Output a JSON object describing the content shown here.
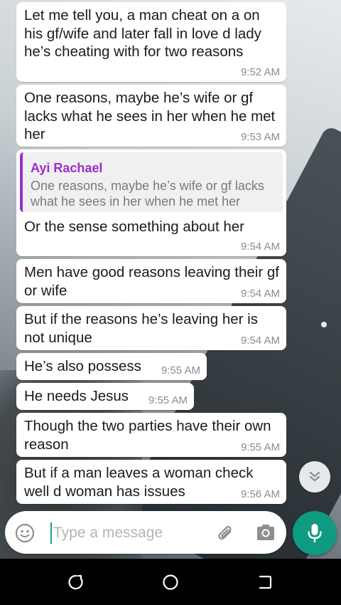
{
  "composer": {
    "placeholder": "Type a message"
  },
  "messages": [
    {
      "text": "Let me tell you, a man cheat on a on his gf/wife and later fall in love d lady he’s cheating with for two reasons",
      "time": "9:52 AM"
    },
    {
      "text": "One reasons, maybe he’s wife or gf lacks what he sees in her when he met her",
      "time": "9:53 AM"
    },
    {
      "quote": {
        "author": "Ayi Rachael",
        "text": "One reasons, maybe he’s wife or gf lacks what he sees in her when he met her"
      },
      "text": "Or the sense something about her",
      "time": "9:54 AM"
    },
    {
      "text": "Men have good reasons leaving their gf or wife",
      "time": "9:54 AM"
    },
    {
      "text": "But if the reasons he’s leaving her is not unique",
      "time": "9:54 AM"
    },
    {
      "text": "He’s also possess",
      "time": "9:55 AM"
    },
    {
      "text": "He needs Jesus",
      "time": "9:55 AM"
    },
    {
      "text": "Though the two parties have their own reason",
      "time": "9:55 AM"
    },
    {
      "text": "But if a man leaves a woman check well d woman has issues",
      "time": "9:56 AM"
    }
  ],
  "icons": {
    "emoji": "emoji-icon",
    "attach": "paperclip-icon",
    "camera": "camera-icon",
    "mic": "microphone-icon",
    "scroll_down": "double-chevron-down-icon",
    "nav_recents": "recents-icon",
    "nav_home": "home-icon",
    "nav_back": "back-icon"
  },
  "colors": {
    "accent": "#0f9b82",
    "quote_author": "#9c2ec7",
    "bubble": "#ffffff",
    "timestamp": "#8c8c8c"
  }
}
